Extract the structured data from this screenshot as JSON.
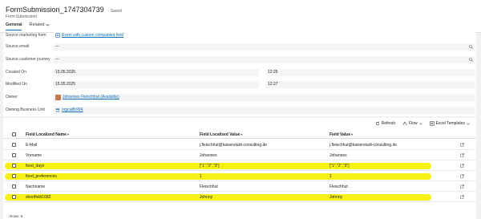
{
  "header": {
    "title": "FormSubmission_1747304739",
    "status": "- Saved",
    "entity": "Form Submission",
    "tabs": [
      {
        "label": "General",
        "active": true
      },
      {
        "label": "Related",
        "active": false
      }
    ]
  },
  "form": {
    "source_marketing_form": {
      "label": "Source marketing form",
      "value": "Event with custom compabled field"
    },
    "source_email": {
      "label": "Source email",
      "value": "---"
    },
    "source_customer_journey": {
      "label": "Source customer journey",
      "value": "---"
    },
    "created_on": {
      "label": "Created On",
      "date": "15.05.2025",
      "time": "12:25"
    },
    "modified_on": {
      "label": "Modified On",
      "date": "15.05.2025",
      "time": "12:27"
    },
    "owner": {
      "label": "Owner",
      "value": "Johannes Fleischhut (Available)"
    },
    "owning_business_unit": {
      "label": "Owning Business Unit",
      "value": "orgca8b994"
    }
  },
  "grid": {
    "commands": {
      "refresh": "Refresh",
      "flow": "Flow",
      "excel": "Excel Templates"
    },
    "columns": {
      "name": "Field Localized Name",
      "localized_value": "Field Localized Value",
      "value": "Field Value"
    },
    "rows": [
      {
        "name": "E-Mail",
        "localized_value": "j.fleischhut@kaiserstadt-consulting.de",
        "value": "j.fleischhut@kaiserstadt-consulting.de",
        "highlighted": false
      },
      {
        "name": "Vorname",
        "localized_value": "Johannes",
        "value": "Johannes",
        "highlighted": false
      },
      {
        "name": "food_days",
        "localized_value": "[\"1\",\"2\",\"3\"]",
        "value": "[\"1\",\"2\",\"3\"]",
        "highlighted": true
      },
      {
        "name": "food_preferences",
        "localized_value": "1",
        "value": "1",
        "highlighted": true
      },
      {
        "name": "Nachname",
        "localized_value": "Fleischhut",
        "value": "Fleischhut",
        "highlighted": false
      },
      {
        "name": "shortfield1682",
        "localized_value": "Johnny",
        "value": "Johnny",
        "highlighted": true
      }
    ],
    "rows_count": "Rows: 6"
  },
  "colors": {
    "accent": "#0f6cbd",
    "highlight": "#f5ef00"
  }
}
